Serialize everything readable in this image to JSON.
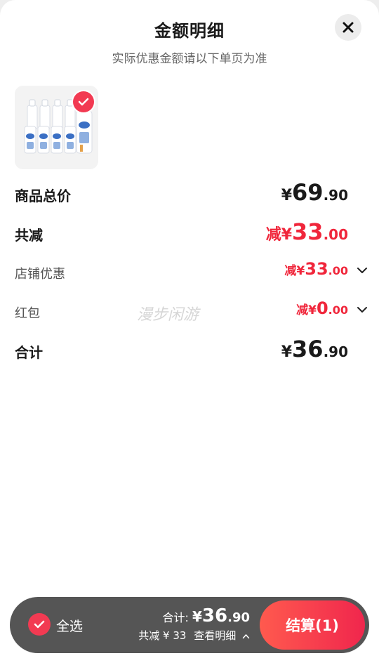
{
  "header": {
    "title": "金额明细",
    "subtitle": "实际优惠金额请以下单页为准"
  },
  "product": {
    "selected": true
  },
  "summary": {
    "goods_total": {
      "label": "商品总价",
      "currency": "¥",
      "int": "69",
      "dec": ".90"
    },
    "total_reduce": {
      "label": "共减",
      "prefix": "减",
      "currency": "¥",
      "int": "33",
      "dec": ".00"
    },
    "store_discount": {
      "label": "店铺优惠",
      "prefix": "减",
      "currency": "¥",
      "int": "33",
      "dec": ".00"
    },
    "red_packet": {
      "label": "红包",
      "prefix": "减",
      "currency": "¥",
      "int": "0",
      "dec": ".00"
    },
    "grand_total": {
      "label": "合计",
      "currency": "¥",
      "int": "36",
      "dec": ".90"
    }
  },
  "watermark": "漫步闲游",
  "bottom_bar": {
    "select_all": "全选",
    "total_label": "合计:",
    "total_currency": "¥",
    "total_int": "36",
    "total_dec": ".90",
    "reduce_text": "共减 ¥ 33",
    "detail_link": "查看明细",
    "checkout": "结算(1)"
  },
  "colors": {
    "accent_red": "#f0263b",
    "checkout_gradient": [
      "#ff5a4e",
      "#f0264d"
    ],
    "bar_bg": "#555555"
  }
}
